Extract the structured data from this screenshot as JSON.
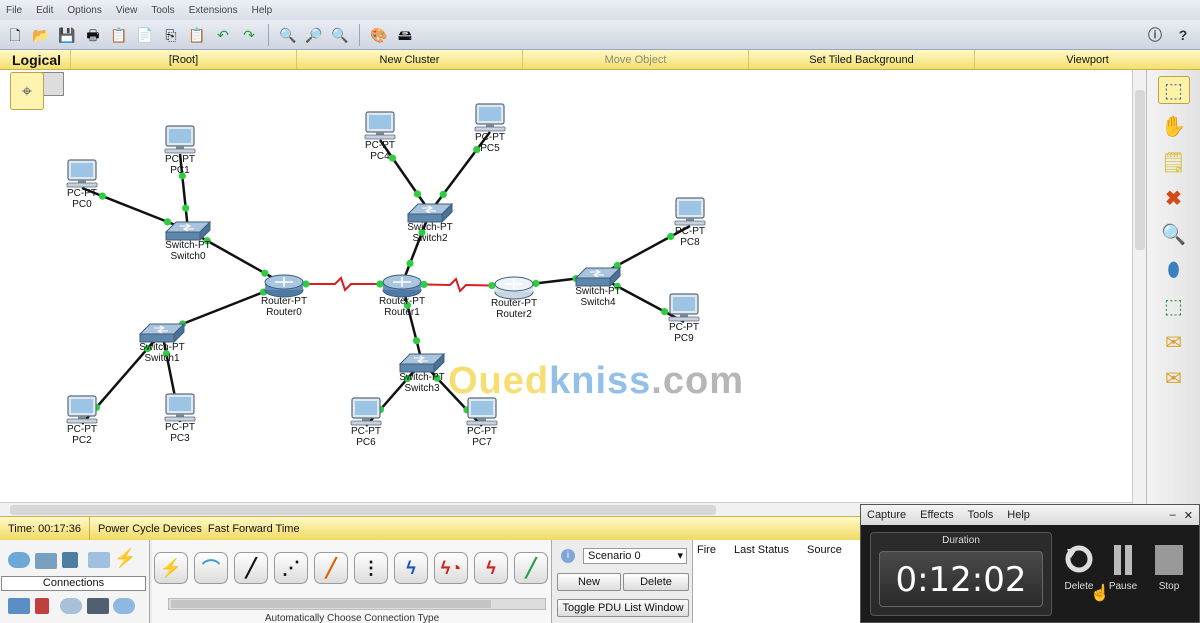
{
  "menu": [
    "File",
    "Edit",
    "Options",
    "View",
    "Tools",
    "Extensions",
    "Help"
  ],
  "toolbar": {
    "icons": [
      "new-file-icon",
      "open-folder-icon",
      "save-icon",
      "print-icon",
      "activity-wizard-icon",
      "activity-wizard-icon",
      "copy-icon",
      "paste-icon",
      "undo-icon",
      "redo-icon",
      "zoom-in-icon",
      "zoom-reset-icon",
      "zoom-out-icon",
      "palette-icon",
      "custom-device-icon"
    ],
    "right_icons": [
      "info-icon",
      "help-icon"
    ]
  },
  "workspace": {
    "mode": "Logical",
    "cells": [
      "[Root]",
      "New Cluster",
      "Move Object",
      "Set Tiled Background",
      "Viewport"
    ]
  },
  "devices": [
    {
      "id": "PC0",
      "type": "PC-PT"
    },
    {
      "id": "PC1",
      "type": "PC-PT"
    },
    {
      "id": "PC2",
      "type": "PC-PT"
    },
    {
      "id": "PC3",
      "type": "PC-PT"
    },
    {
      "id": "PC4",
      "type": "PC-PT"
    },
    {
      "id": "PC5",
      "type": "PC-PT"
    },
    {
      "id": "PC6",
      "type": "PC-PT"
    },
    {
      "id": "PC7",
      "type": "PC-PT"
    },
    {
      "id": "PC8",
      "type": "PC-PT"
    },
    {
      "id": "PC9",
      "type": "PC-PT"
    },
    {
      "id": "Switch0",
      "type": "Switch-PT"
    },
    {
      "id": "Switch1",
      "type": "Switch-PT"
    },
    {
      "id": "Switch2",
      "type": "Switch-PT"
    },
    {
      "id": "Switch3",
      "type": "Switch-PT"
    },
    {
      "id": "Switch4",
      "type": "Switch-PT"
    },
    {
      "id": "Router0",
      "type": "Router-PT"
    },
    {
      "id": "Router1",
      "type": "Router-PT"
    },
    {
      "id": "Router2",
      "type": "Router-PT"
    }
  ],
  "links": [
    [
      "PC0",
      "Switch0",
      "ethernet"
    ],
    [
      "PC1",
      "Switch0",
      "ethernet"
    ],
    [
      "Switch0",
      "Router0",
      "ethernet"
    ],
    [
      "PC2",
      "Switch1",
      "ethernet"
    ],
    [
      "PC3",
      "Switch1",
      "ethernet"
    ],
    [
      "Switch1",
      "Router0",
      "ethernet"
    ],
    [
      "Router0",
      "Router1",
      "serial"
    ],
    [
      "Router1",
      "Router2",
      "serial"
    ],
    [
      "PC4",
      "Switch2",
      "ethernet"
    ],
    [
      "PC5",
      "Switch2",
      "ethernet"
    ],
    [
      "Switch2",
      "Router1",
      "ethernet"
    ],
    [
      "PC6",
      "Switch3",
      "ethernet"
    ],
    [
      "PC7",
      "Switch3",
      "ethernet"
    ],
    [
      "Switch3",
      "Router1",
      "ethernet"
    ],
    [
      "Router2",
      "Switch4",
      "ethernet"
    ],
    [
      "Switch4",
      "PC8",
      "ethernet"
    ],
    [
      "Switch4",
      "PC9",
      "ethernet"
    ]
  ],
  "colors": {
    "ethernet": "#111111",
    "serial": "#d42020",
    "link_light": "#2ecc40"
  },
  "palette_tools": [
    "select-icon",
    "hand-move-icon",
    "note-icon",
    "delete-icon",
    "inspect-icon",
    "draw-shape-icon",
    "resize-icon",
    "simple-pdu-icon",
    "complex-pdu-icon"
  ],
  "status": {
    "time": "Time: 00:17:36",
    "power_cycle": "Power Cycle Devices",
    "fast_forward": "Fast Forward Time"
  },
  "bottom": {
    "category_label": "Connections",
    "cable_hint": "Automatically Choose Connection Type",
    "scenario": "Scenario 0",
    "new_label": "New",
    "delete_label": "Delete",
    "toggle_label": "Toggle PDU List Window",
    "pdu_headers": [
      "Fire",
      "Last Status",
      "Source"
    ]
  },
  "recorder": {
    "menu": [
      "Capture",
      "Effects",
      "Tools",
      "Help"
    ],
    "duration_label": "Duration",
    "duration": "0:12:02",
    "buttons": [
      "Delete",
      "Pause",
      "Stop"
    ]
  },
  "watermark": {
    "part1": "Oued",
    "part2": "kniss",
    "part3": ".com"
  }
}
